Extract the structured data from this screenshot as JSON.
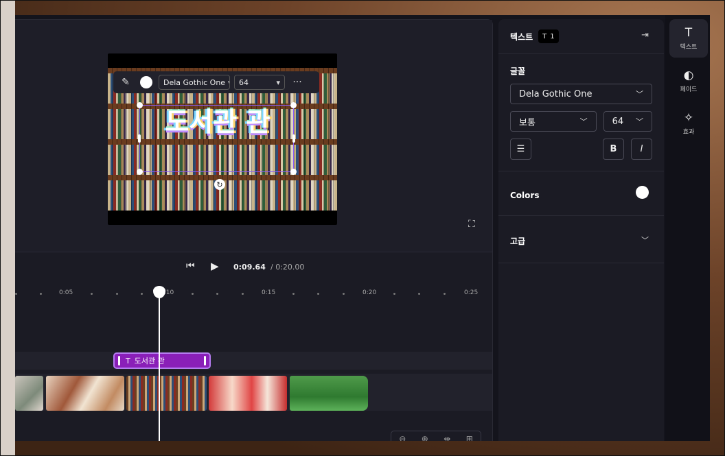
{
  "preview": {
    "overlay_text": "도서관 관",
    "toolbar": {
      "font": "Dela Gothic One",
      "size": "64",
      "more": "···"
    }
  },
  "playback": {
    "current_time": "0:09.64",
    "total_time": "/ 0:20.00"
  },
  "ruler": {
    "labels": [
      "0:05",
      "0:10",
      "0:15",
      "0:20",
      "0:25"
    ]
  },
  "timeline": {
    "text_clip_label": "도서관 관"
  },
  "panel": {
    "title": "텍스트",
    "badge_count": "1",
    "font_section_label": "글꼴",
    "font_family": "Dela Gothic One",
    "font_weight": "보통",
    "font_size": "64",
    "bold_label": "B",
    "italic_label": "I",
    "colors_label": "Colors",
    "text_color": "#ffffff",
    "advanced_label": "고급"
  },
  "rail": {
    "items": [
      {
        "label": "텍스트",
        "icon": "text-icon",
        "active": true
      },
      {
        "label": "페이드",
        "icon": "fade-icon",
        "active": false
      },
      {
        "label": "효과",
        "icon": "effects-wand-icon",
        "active": false
      }
    ]
  },
  "colors": {
    "accent_purple": "#8a1fb8",
    "selection": "#8b5cf6",
    "panel_bg": "#1b1b24"
  }
}
